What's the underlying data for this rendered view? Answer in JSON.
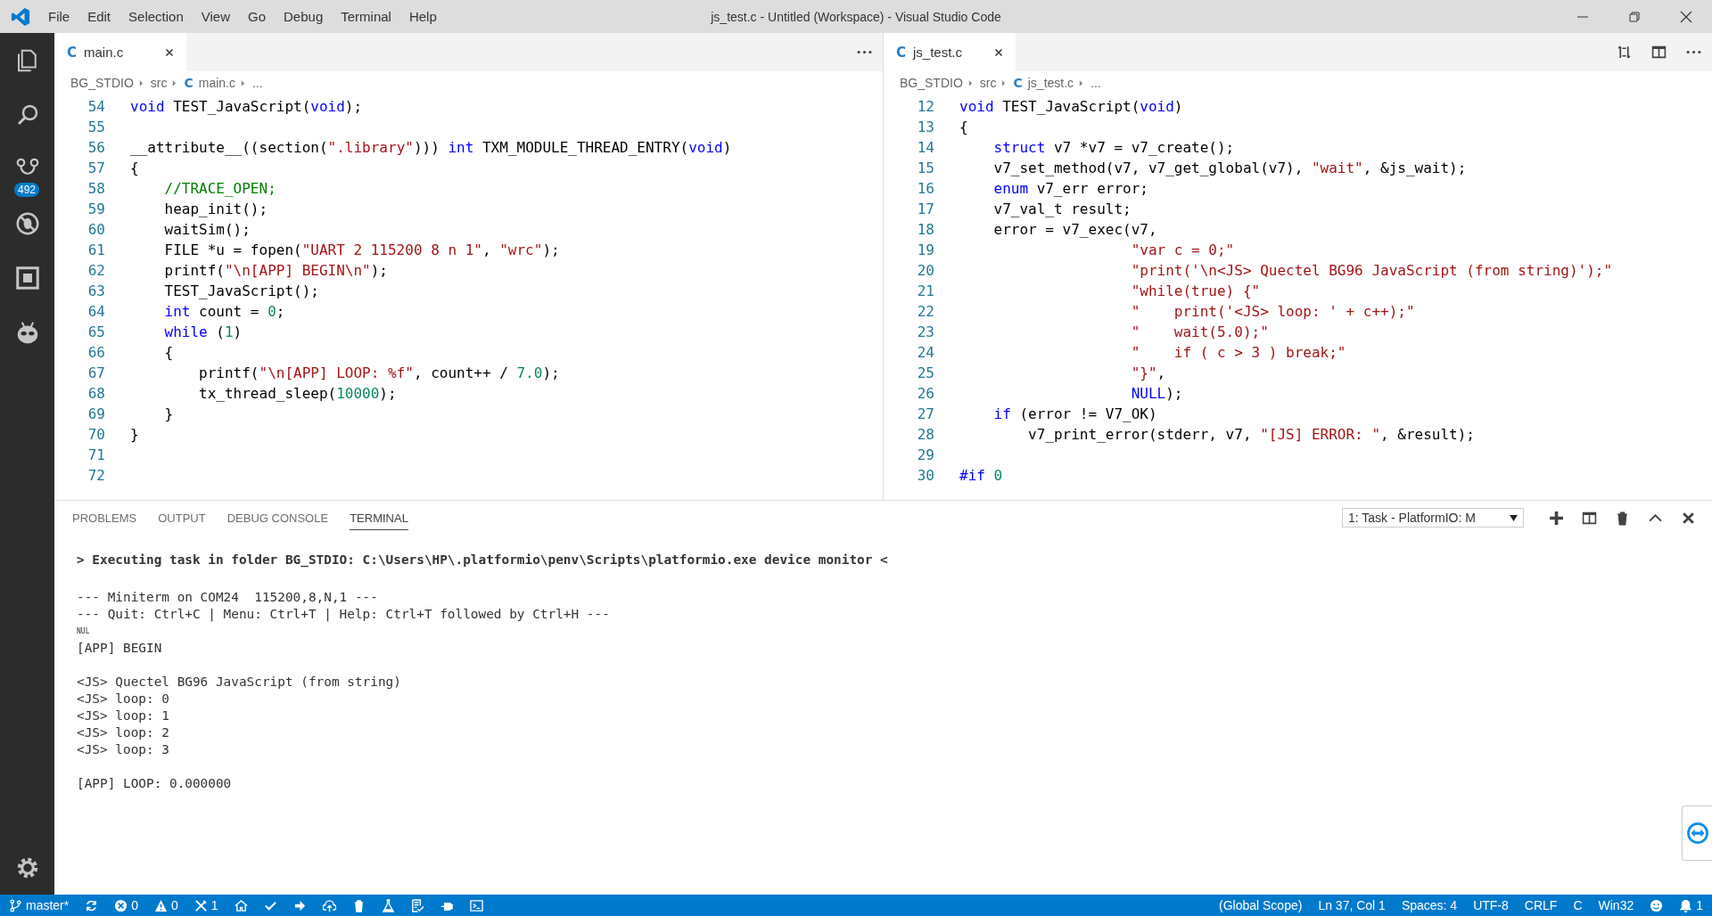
{
  "window": {
    "title": "js_test.c - Untitled (Workspace) - Visual Studio Code"
  },
  "menu": [
    "File",
    "Edit",
    "Selection",
    "View",
    "Go",
    "Debug",
    "Terminal",
    "Help"
  ],
  "activity_bar": {
    "items": [
      {
        "kind": "files"
      },
      {
        "kind": "search"
      },
      {
        "kind": "source-control",
        "badge": "492"
      },
      {
        "kind": "debug"
      },
      {
        "kind": "extensions"
      },
      {
        "kind": "platformio"
      }
    ],
    "bottom": [
      {
        "kind": "settings"
      }
    ]
  },
  "editors": [
    {
      "tab": {
        "icon": "C",
        "label": "main.c"
      },
      "actions": [
        {
          "kind": "more"
        }
      ],
      "breadcrumb": [
        {
          "text": "BG_STDIO"
        },
        {
          "text": "src"
        },
        {
          "icon": "C",
          "text": "main.c"
        },
        {
          "text": "..."
        }
      ],
      "lines": [
        {
          "number": "54",
          "tokens": [
            {
              "kind": "keyword",
              "text": "void"
            },
            " TEST_JavaScript(",
            {
              "kind": "keyword",
              "text": "void"
            },
            ");"
          ]
        },
        {
          "number": "55"
        },
        {
          "number": "56",
          "tokens": [
            "__attribute__((section(",
            {
              "kind": "string",
              "text": "\".library\""
            },
            "))) ",
            {
              "kind": "keyword",
              "text": "int"
            },
            " TXM_MODULE_THREAD_ENTRY(",
            {
              "kind": "keyword",
              "text": "void"
            },
            ")"
          ]
        },
        {
          "number": "57",
          "tokens": [
            "{"
          ]
        },
        {
          "number": "58",
          "tokens": [
            {
              "kind": "comment",
              "text": "    //TRACE_OPEN;"
            }
          ]
        },
        {
          "number": "59",
          "tokens": [
            "    heap_init();"
          ]
        },
        {
          "number": "60",
          "tokens": [
            "    waitSim();"
          ]
        },
        {
          "number": "61",
          "tokens": [
            "    FILE *u = fopen(",
            {
              "kind": "string",
              "text": "\"UART 2 115200 8 n 1\""
            },
            ", ",
            {
              "kind": "string",
              "text": "\"wrc\""
            },
            ");"
          ]
        },
        {
          "number": "62",
          "tokens": [
            "    printf(",
            {
              "kind": "string",
              "text": "\"\\n[APP] BEGIN\\n\""
            },
            ");"
          ]
        },
        {
          "number": "63",
          "tokens": [
            "    TEST_JavaScript();"
          ]
        },
        {
          "number": "64",
          "tokens": [
            {
              "kind": "keyword",
              "text": "    int"
            },
            " count = ",
            {
              "kind": "number",
              "text": "0"
            },
            ";"
          ]
        },
        {
          "number": "65",
          "tokens": [
            {
              "kind": "keyword",
              "text": "    while"
            },
            " (",
            {
              "kind": "number",
              "text": "1"
            },
            ")"
          ]
        },
        {
          "number": "66",
          "tokens": [
            "    {"
          ]
        },
        {
          "number": "67",
          "tokens": [
            "        printf(",
            {
              "kind": "string",
              "text": "\"\\n[APP] LOOP: %f\""
            },
            ", count++ / ",
            {
              "kind": "number",
              "text": "7.0"
            },
            ");"
          ]
        },
        {
          "number": "68",
          "tokens": [
            "        tx_thread_sleep(",
            {
              "kind": "number",
              "text": "10000"
            },
            ");"
          ]
        },
        {
          "number": "69",
          "tokens": [
            "    }"
          ]
        },
        {
          "number": "70",
          "tokens": [
            "}"
          ]
        },
        {
          "number": "71"
        },
        {
          "number": "72"
        }
      ]
    },
    {
      "tab": {
        "icon": "C",
        "label": "js_test.c"
      },
      "actions": [
        {
          "kind": "compare"
        },
        {
          "kind": "split"
        },
        {
          "kind": "more"
        }
      ],
      "breadcrumb": [
        {
          "text": "BG_STDIO"
        },
        {
          "text": "src"
        },
        {
          "icon": "C",
          "text": "js_test.c"
        },
        {
          "text": "..."
        }
      ],
      "lines": [
        {
          "number": "12",
          "tokens": [
            {
              "kind": "keyword",
              "text": "void"
            },
            " TEST_JavaScript(",
            {
              "kind": "keyword",
              "text": "void"
            },
            ")"
          ]
        },
        {
          "number": "13",
          "tokens": [
            "{"
          ]
        },
        {
          "number": "14",
          "tokens": [
            {
              "kind": "keyword",
              "text": "    struct"
            },
            " v7 *v7 = v7_create();"
          ]
        },
        {
          "number": "15",
          "tokens": [
            "    v7_set_method(v7, v7_get_global(v7), ",
            {
              "kind": "string",
              "text": "\"wait\""
            },
            ", &js_wait);"
          ]
        },
        {
          "number": "16",
          "tokens": [
            {
              "kind": "keyword",
              "text": "    enum"
            },
            " v7_err error;"
          ]
        },
        {
          "number": "17",
          "tokens": [
            "    v7_val_t result;"
          ]
        },
        {
          "number": "18",
          "tokens": [
            "    error = v7_exec(v7,"
          ]
        },
        {
          "number": "19",
          "tokens": [
            {
              "kind": "string",
              "text": "                    \"var c = 0;\""
            }
          ]
        },
        {
          "number": "20",
          "tokens": [
            {
              "kind": "string",
              "text": "                    \"print('\\n<JS> Quectel BG96 JavaScript (from string)');\""
            }
          ]
        },
        {
          "number": "21",
          "tokens": [
            {
              "kind": "string",
              "text": "                    \"while(true) {\""
            }
          ]
        },
        {
          "number": "22",
          "tokens": [
            {
              "kind": "string",
              "text": "                    \"    print('<JS> loop: ' + c++);\""
            }
          ]
        },
        {
          "number": "23",
          "tokens": [
            {
              "kind": "string",
              "text": "                    \"    wait(5.0);\""
            }
          ]
        },
        {
          "number": "24",
          "tokens": [
            {
              "kind": "string",
              "text": "                    \"    if ( c > 3 ) break;\""
            }
          ]
        },
        {
          "number": "25",
          "tokens": [
            {
              "kind": "string",
              "text": "                    \"}\""
            },
            ","
          ]
        },
        {
          "number": "26",
          "tokens": [
            {
              "kind": "keyword",
              "text": "                    NULL"
            },
            ");"
          ]
        },
        {
          "number": "27",
          "tokens": [
            {
              "kind": "keyword",
              "text": "    if"
            },
            " (error != V7_OK)"
          ]
        },
        {
          "number": "28",
          "tokens": [
            "        v7_print_error(stderr, v7, ",
            {
              "kind": "string",
              "text": "\"[JS] ERROR: \""
            },
            ", &result);"
          ]
        },
        {
          "number": "29"
        },
        {
          "number": "30",
          "tokens": [
            {
              "kind": "keyword",
              "text": "#if"
            },
            {
              "kind": "number",
              "text": " 0"
            }
          ]
        }
      ]
    }
  ],
  "panel": {
    "tabs": [
      {
        "label": "PROBLEMS",
        "selected": false
      },
      {
        "label": "OUTPUT",
        "selected": false
      },
      {
        "label": "DEBUG CONSOLE",
        "selected": false
      },
      {
        "label": "TERMINAL",
        "selected": true
      }
    ],
    "terminal_select": "1: Task - PlatformIO: M",
    "actions": [
      {
        "kind": "add"
      },
      {
        "kind": "split"
      },
      {
        "kind": "trash"
      },
      {
        "kind": "maximize"
      },
      {
        "kind": "close"
      }
    ],
    "terminal": [
      {
        "kind": "command",
        "text": "> Executing task in folder BG_STDIO: C:\\Users\\HP\\.platformio\\penv\\Scripts\\platformio.exe device monitor <"
      },
      {
        "kind": "blank"
      },
      {
        "kind": "output",
        "text": "--- Miniterm on COM24  115200,8,N,1 ---"
      },
      {
        "kind": "output",
        "text": "--- Quit: Ctrl+C | Menu: Ctrl+T | Help: Ctrl+T followed by Ctrl+H ---"
      },
      {
        "kind": "control",
        "text": "NUL"
      },
      {
        "kind": "output",
        "text": "[APP] BEGIN"
      },
      {
        "kind": "blank"
      },
      {
        "kind": "output",
        "text": "<JS> Quectel BG96 JavaScript (from string)"
      },
      {
        "kind": "output",
        "text": "<JS> loop: 0"
      },
      {
        "kind": "output",
        "text": "<JS> loop: 1"
      },
      {
        "kind": "output",
        "text": "<JS> loop: 2"
      },
      {
        "kind": "output",
        "text": "<JS> loop: 3"
      },
      {
        "kind": "blank"
      },
      {
        "kind": "output",
        "text": "[APP] LOOP: 0.000000"
      }
    ]
  },
  "status_bar": {
    "left": [
      {
        "kind": "branch",
        "text": "master*"
      },
      {
        "kind": "sync"
      },
      {
        "kind": "errors",
        "text": "0"
      },
      {
        "kind": "warnings",
        "text": "0"
      },
      {
        "kind": "tools",
        "text": "1"
      },
      {
        "kind": "home"
      },
      {
        "kind": "check"
      },
      {
        "kind": "arrow"
      },
      {
        "kind": "upload"
      },
      {
        "kind": "trash"
      },
      {
        "kind": "flask"
      },
      {
        "kind": "checklist"
      },
      {
        "kind": "plug"
      },
      {
        "kind": "terminal"
      }
    ],
    "right": [
      {
        "kind": "text",
        "text": "(Global Scope)"
      },
      {
        "kind": "text",
        "text": "Ln 37, Col 1"
      },
      {
        "kind": "text",
        "text": "Spaces: 4"
      },
      {
        "kind": "text",
        "text": "UTF-8"
      },
      {
        "kind": "text",
        "text": "CRLF"
      },
      {
        "kind": "text",
        "text": "C"
      },
      {
        "kind": "text",
        "text": "Win32"
      },
      {
        "kind": "smiley"
      },
      {
        "kind": "bell",
        "text": "1"
      }
    ]
  }
}
